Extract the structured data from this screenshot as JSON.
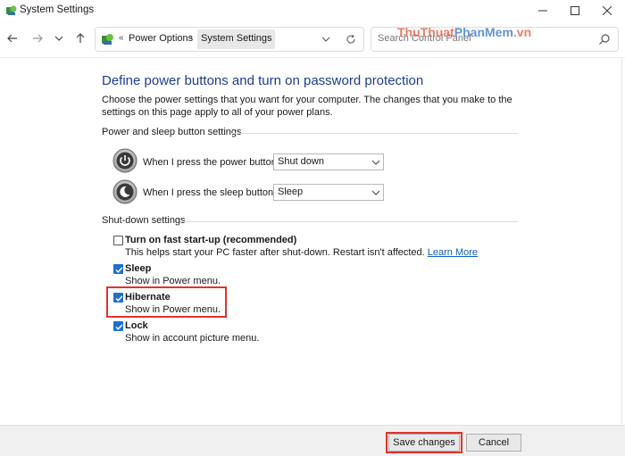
{
  "window": {
    "title": "System Settings",
    "icon": "control-panel-icon"
  },
  "address_bar": {
    "overflow": "«",
    "crumbs": [
      "Power Options",
      "System Settings"
    ],
    "separator": "›"
  },
  "search": {
    "placeholder": "Search Control Panel"
  },
  "watermark": {
    "part1": "ThuThuat",
    "part2": "PhanMem",
    "part3": ".vn"
  },
  "content": {
    "heading": "Define power buttons and turn on password protection",
    "description": "Choose the power settings that you want for your computer. The changes that you make to the settings on this page apply to all of your power plans.",
    "power_sleep_group": "Power and sleep button settings",
    "power_button": {
      "label": "When I press the power button:",
      "value": "Shut down"
    },
    "sleep_button": {
      "label": "When I press the sleep button:",
      "value": "Sleep"
    },
    "shutdown_group": "Shut-down settings",
    "options": [
      {
        "label": "Turn on fast start-up (recommended)",
        "sub": "This helps start your PC faster after shut-down. Restart isn't affected.",
        "link": "Learn More",
        "checked": false
      },
      {
        "label": "Sleep",
        "sub": "Show in Power menu.",
        "checked": true
      },
      {
        "label": "Hibernate",
        "sub": "Show in Power menu.",
        "checked": true
      },
      {
        "label": "Lock",
        "sub": "Show in account picture menu.",
        "checked": true
      }
    ]
  },
  "footer": {
    "save_label": "Save changes",
    "cancel_label": "Cancel"
  },
  "colors": {
    "heading": "#1e3d8f",
    "checkbox_checked": "#1f6fd1",
    "highlight": "#e0332f",
    "link": "#0f5fc2"
  }
}
